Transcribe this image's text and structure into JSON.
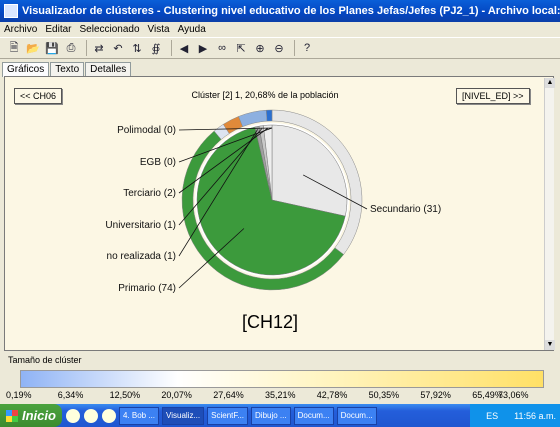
{
  "window": {
    "title": "Visualizador de clústeres - Clustering nivel educativo de los Planes Jefas/Jefes (PJ2_1) - Archivo local: general I..."
  },
  "menu": [
    "Archivo",
    "Editar",
    "Seleccionado",
    "Vista",
    "Ayuda"
  ],
  "toolbar": {
    "icons": [
      "new-icon",
      "open-icon",
      "save-icon",
      "print-icon",
      "sep",
      "swap-icon",
      "undo-icon",
      "sort-icon",
      "filter-icon",
      "sep",
      "left-icon",
      "right-icon",
      "link-icon",
      "zoom-fit-icon",
      "zoom-in-icon",
      "zoom-out-icon",
      "sep",
      "help-icon"
    ]
  },
  "tabs": [
    {
      "label": "Gráficos",
      "active": true
    },
    {
      "label": "Texto",
      "active": false
    },
    {
      "label": "Detalles",
      "active": false
    }
  ],
  "nav": {
    "prev": "<< CH06",
    "next": "[NIVEL_ED] >>"
  },
  "header": "Clúster [2] 1, 20,68% de la población",
  "cluster_name": "[CH12]",
  "chart_data": {
    "type": "pie",
    "categories": [
      "Secundario",
      "Primario",
      "no realizada",
      "Universitario",
      "Terciario",
      "EGB",
      "Polimodal"
    ],
    "values": [
      31,
      74,
      1,
      1,
      2,
      0,
      0
    ],
    "labels": [
      "Secundario (31)",
      "Primario (74)",
      "no realizada (1)",
      "Universitario (1)",
      "Terciario (2)",
      "EGB (0)",
      "Polimodal (0)"
    ],
    "colors": [
      "#e8e8e8",
      "#3c9a3c",
      "#a0a0a0",
      "#c8c8c8",
      "#eeeeee",
      "#cccccc",
      "#bbbbbb"
    ],
    "outer_ring": {
      "categories": [
        "Secundario",
        "Primario",
        "Pale",
        "Orange",
        "Blue",
        "Darkblue"
      ],
      "values": [
        35,
        53,
        2,
        3,
        5,
        1
      ],
      "colors": [
        "#e6e6e6",
        "#3c9a3c",
        "#dde4f0",
        "#e08a3a",
        "#8db0e0",
        "#2a6fd0"
      ]
    }
  },
  "size_panel": {
    "label": "Tamaño de clúster",
    "ticks": [
      "0,19%",
      "6,34%",
      "12,50%",
      "20,07%",
      "27,64%",
      "35,21%",
      "42,78%",
      "50,35%",
      "57,92%",
      "65,49%",
      "73,06%"
    ]
  },
  "taskbar": {
    "start": "Inicio",
    "tasks": [
      {
        "label": "4. Bob ...",
        "active": false
      },
      {
        "label": "Visualiz...",
        "active": true
      },
      {
        "label": "ScientF...",
        "active": false
      },
      {
        "label": "Dibujo ...",
        "active": false
      },
      {
        "label": "Docum...",
        "active": false
      },
      {
        "label": "Docum...",
        "active": false
      }
    ],
    "lang": "ES",
    "clock": "11:56 a.m."
  }
}
